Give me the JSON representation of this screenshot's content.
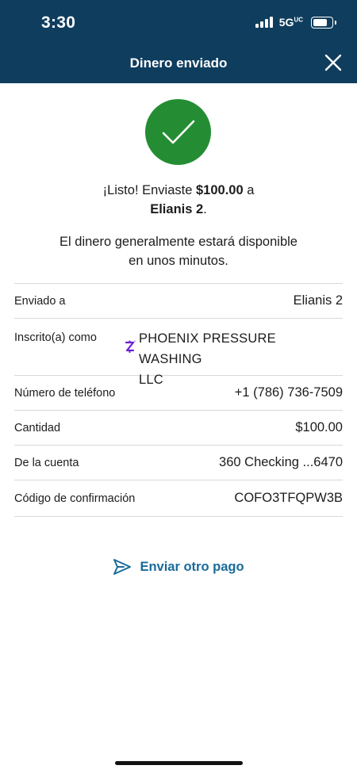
{
  "status_bar": {
    "time": "3:30",
    "network": "5G",
    "network_sup": "UC",
    "signal_bars": 4,
    "battery_level": 0.8
  },
  "nav": {
    "title": "Dinero enviado",
    "close_icon": "close-icon"
  },
  "success": {
    "icon": "checkmark-icon",
    "color": "#248d33",
    "message_prefix": "¡Listo! Enviaste ",
    "amount": "$100.00",
    "message_mid": " a",
    "recipient": "Elianis 2",
    "message_suffix": ".",
    "availability_line1": "El dinero generalmente estará disponible",
    "availability_line2": "en unos minutos."
  },
  "details": {
    "rows": [
      {
        "label": "Enviado a",
        "value": "Elianis 2"
      },
      {
        "label": "Inscrito(a) como",
        "value_line1": "PHOENIX PRESSURE WASHING",
        "value_line2": "LLC",
        "icon": "zelle-icon"
      },
      {
        "label": "Número de teléfono",
        "value": "+1 (786) 736-7509"
      },
      {
        "label": "Cantidad",
        "value": "$100.00"
      },
      {
        "label": "De la cuenta",
        "value": "360 Checking ...6470"
      },
      {
        "label": "Código de confirmación",
        "value": "COFO3TFQPW3B"
      }
    ]
  },
  "actions": {
    "send_again_label": "Enviar otro pago",
    "send_again_icon": "send-icon"
  },
  "colors": {
    "header_bg": "#0f3d5e",
    "accent_link": "#1a6b9a",
    "zelle_purple": "#6d1ed4",
    "divider": "#d9d9d9"
  }
}
